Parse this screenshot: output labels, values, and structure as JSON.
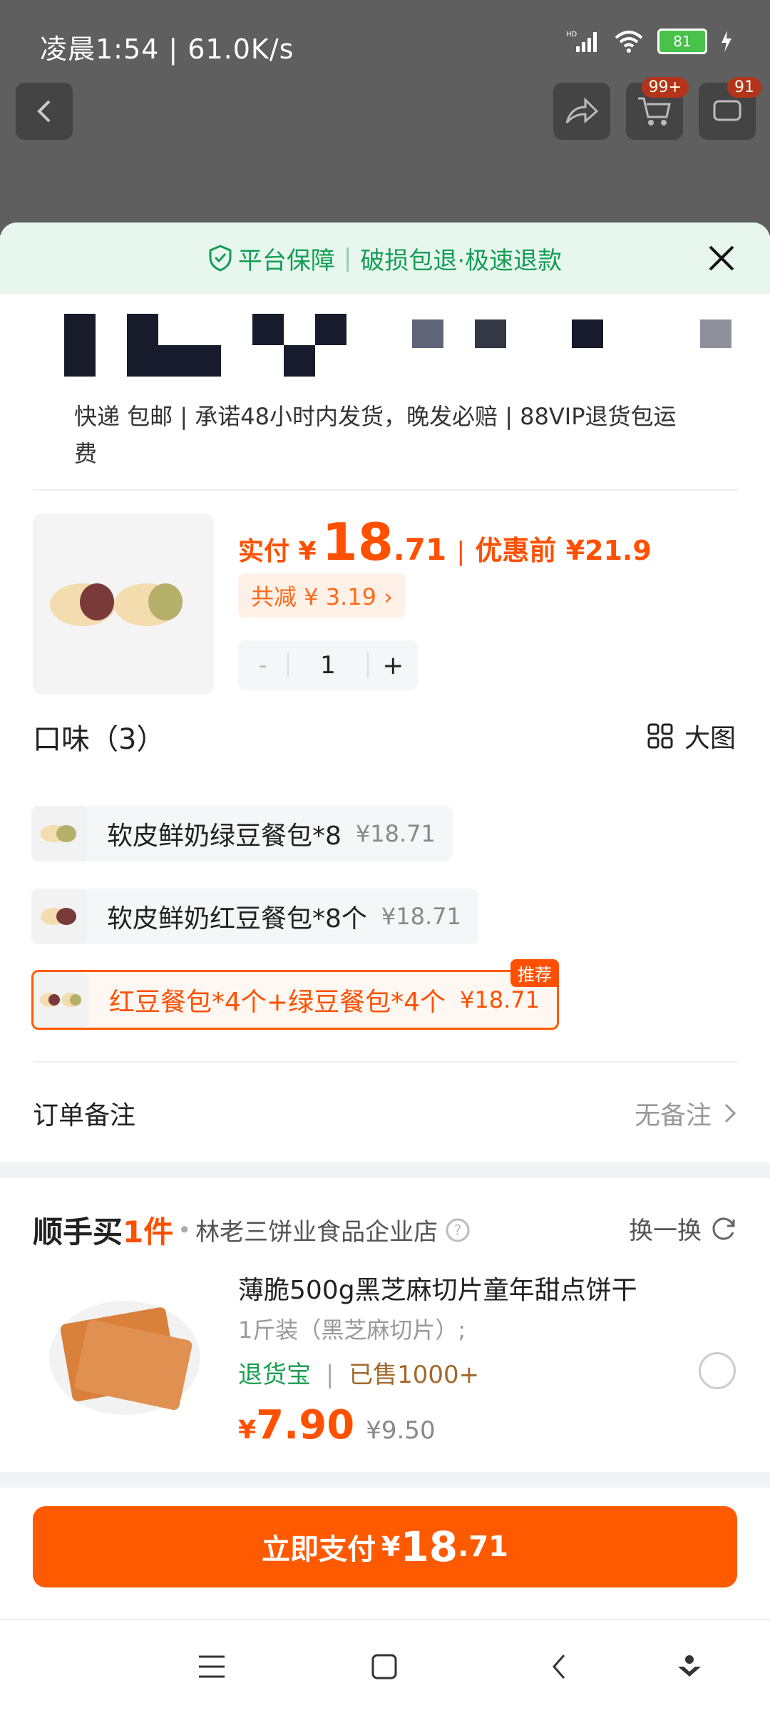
{
  "status_bar": {
    "time_speed": "凌晨1:54 | 61.0K/s",
    "battery": "81"
  },
  "top_nav": {
    "cart_badge": "99+",
    "message_badge": "91"
  },
  "guarantee": {
    "part1": "平台保障",
    "part2": "破损包退·极速退款"
  },
  "shipping": {
    "line": "快递 包邮 | 承诺48小时内发货，晚发必赔 | 88VIP退货包运费"
  },
  "product": {
    "price_label": "实付 ¥",
    "price_int": "18",
    "price_dec": ".71",
    "before_label": "优惠前 ¥21.9",
    "discount": "共减 ¥ 3.19 ›",
    "quantity": "1",
    "minus": "-",
    "plus": "+"
  },
  "flavor": {
    "title": "口味（3）",
    "big_image": "大图",
    "options": [
      {
        "name": "软皮鲜奶绿豆餐包*8",
        "price": "¥18.71"
      },
      {
        "name": "软皮鲜奶红豆餐包*8个",
        "price": "¥18.71"
      },
      {
        "name": "红豆餐包*4个+绿豆餐包*4个",
        "price": "¥18.71",
        "badge": "推荐"
      }
    ]
  },
  "remark": {
    "label": "订单备注",
    "value": "无备注"
  },
  "addon": {
    "logo_main": "顺手买",
    "logo_accent": "1件",
    "shop": "林老三饼业食品企业店",
    "swap": "换一换",
    "title": "薄脆500g黑芝麻切片童年甜点饼干",
    "spec": "1斤装（黑芝麻切片）;",
    "tag_return": "退货宝",
    "tag_sold": "已售1000+",
    "price_yen": "¥",
    "price_value": "7.90",
    "orig_price": "¥9.50"
  },
  "pay": {
    "label": "立即支付",
    "yen": "¥",
    "int": "18",
    "dec": ".71"
  },
  "colors": {
    "accent": "#ff5000",
    "green": "#139d56"
  }
}
